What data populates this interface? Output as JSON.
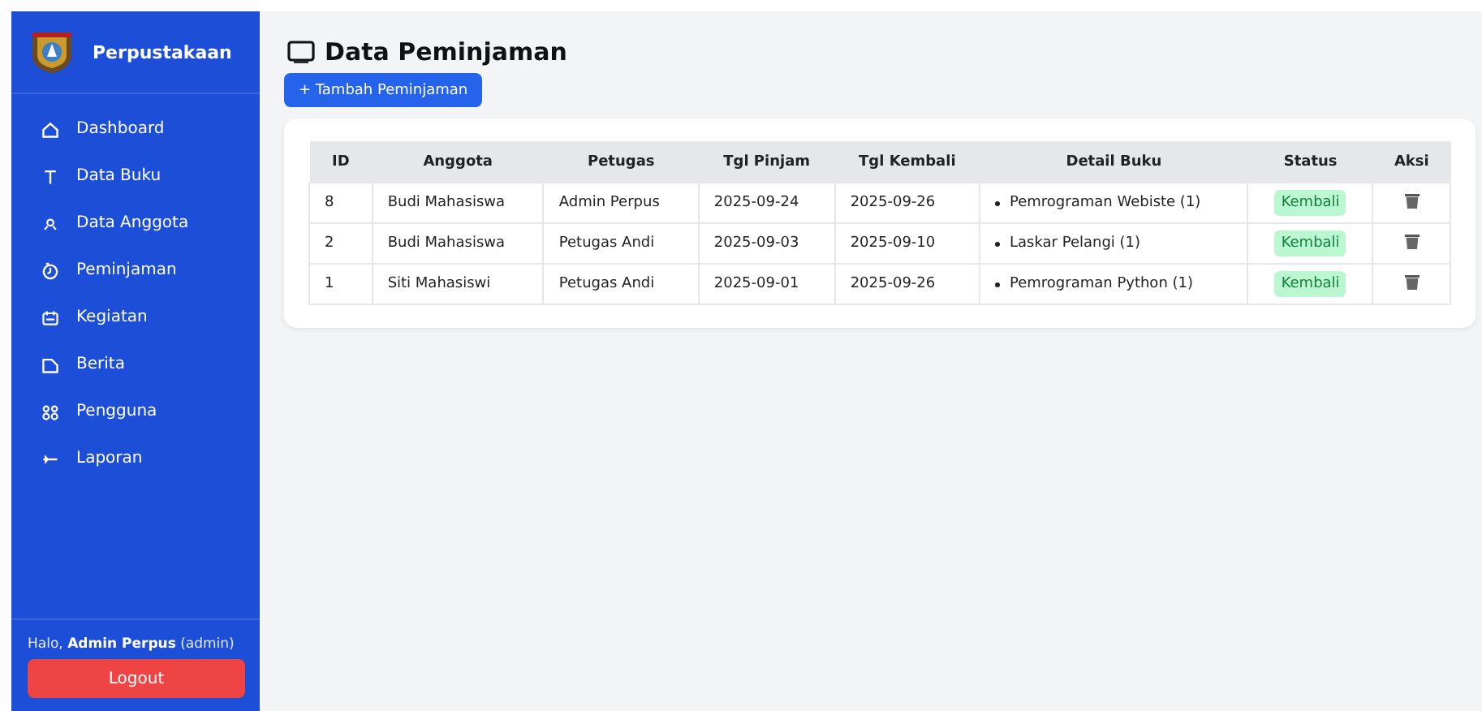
{
  "sidebar": {
    "title": "Perpustakaan",
    "items": [
      {
        "label": "Dashboard"
      },
      {
        "label": "Data Buku"
      },
      {
        "label": "Data Anggota"
      },
      {
        "label": "Peminjaman"
      },
      {
        "label": "Kegiatan"
      },
      {
        "label": "Berita"
      },
      {
        "label": "Pengguna"
      },
      {
        "label": "Laporan"
      }
    ],
    "greeting": "Halo, **Admin Perpus** (admin)",
    "logout": "Logout"
  },
  "page": {
    "title": "Data Peminjaman",
    "add_button": "+ Tambah Peminjaman"
  },
  "table": {
    "columns": [
      "ID",
      "Anggota",
      "Petugas",
      "Tgl Pinjam",
      "Tgl Kembali",
      "Detail Buku",
      "Status",
      "Aksi"
    ],
    "rows": [
      {
        "id": "8",
        "anggota": "Budi Mahasiswa",
        "petugas": "Admin Perpus",
        "tgl_pinjam": "2025-09-24",
        "tgl_kembali": "2025-09-26",
        "books": [
          "Pemrograman Webiste (1)"
        ],
        "status": "Kembali"
      },
      {
        "id": "2",
        "anggota": "Budi Mahasiswa",
        "petugas": "Petugas Andi",
        "tgl_pinjam": "2025-09-03",
        "tgl_kembali": "2025-09-10",
        "books": [
          "Laskar Pelangi (1)"
        ],
        "status": "Kembali"
      },
      {
        "id": "1",
        "anggota": "Siti Mahasiswi",
        "petugas": "Petugas Andi",
        "tgl_pinjam": "2025-09-01",
        "tgl_kembali": "2025-09-26",
        "books": [
          "Pemrograman Python (1)"
        ],
        "status": "Kembali"
      }
    ]
  }
}
